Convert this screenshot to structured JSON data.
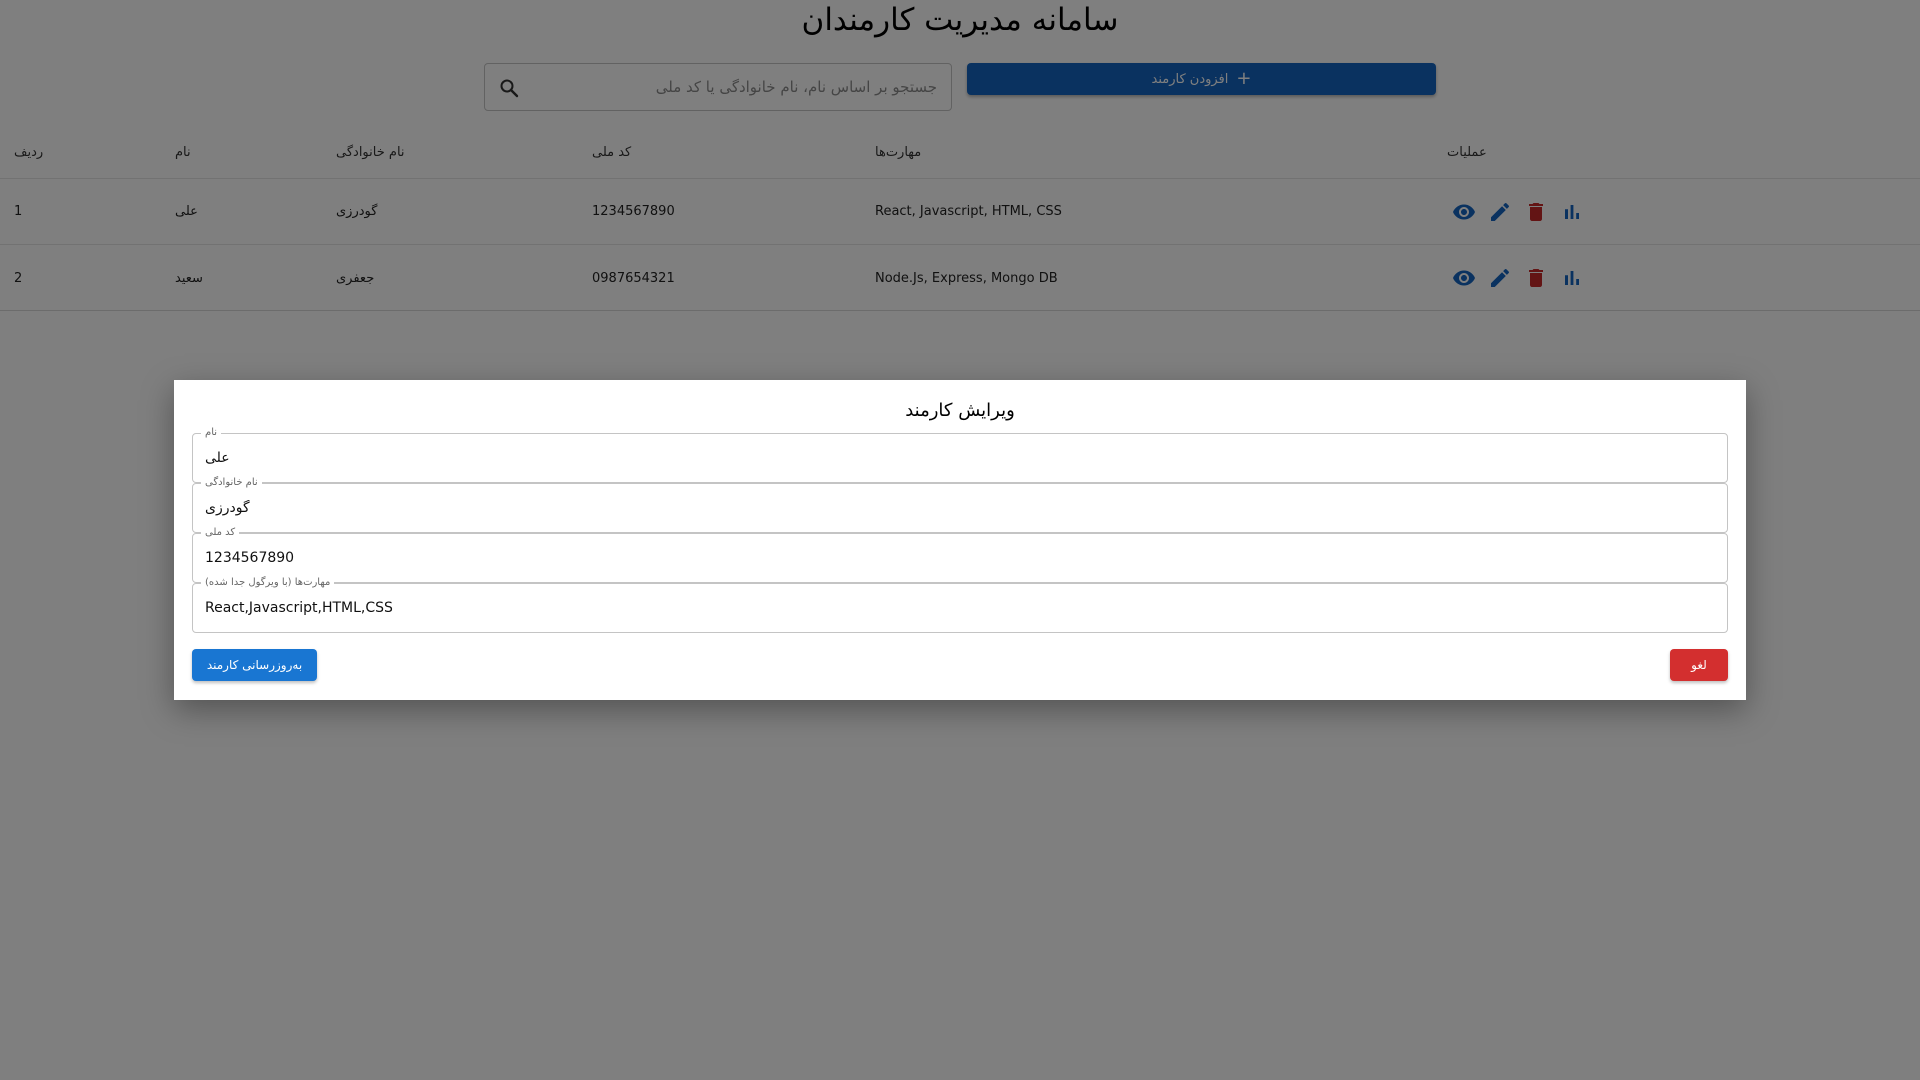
{
  "page": {
    "title": "سامانه مدیریت کارمندان"
  },
  "search": {
    "placeholder": "جستجو بر اساس نام، نام خانوادگی یا کد ملی",
    "value": ""
  },
  "toolbar": {
    "add_label": "افزودن کارمند",
    "add_icon": "plus-icon"
  },
  "table": {
    "headers": {
      "index": "ردیف",
      "name": "نام",
      "family": "نام خانوادگی",
      "national_id": "کد ملی",
      "skills": "مهارت‌ها",
      "operations": "عملیات"
    },
    "rows": [
      {
        "index": "1",
        "name": "علی",
        "family": "گودرزی",
        "national_id": "1234567890",
        "skills": "React, Javascript, HTML, CSS"
      },
      {
        "index": "2",
        "name": "سعید",
        "family": "جعفری",
        "national_id": "0987654321",
        "skills": "Node.Js, Express, Mongo DB"
      }
    ],
    "action_icons": [
      "eye-icon",
      "edit-icon",
      "delete-icon",
      "bar-chart-icon"
    ]
  },
  "dialog": {
    "title": "ویرایش کارمند",
    "fields": [
      {
        "label": "نام",
        "value": "علی"
      },
      {
        "label": "نام خانوادگی",
        "value": "گودرزی"
      },
      {
        "label": "کد ملی",
        "value": "1234567890"
      },
      {
        "label": "مهارت‌ها (با ویرگول جدا شده)",
        "value": "React,Javascript,HTML,CSS"
      }
    ],
    "update_label": "به‌روزرسانی کارمند",
    "cancel_label": "لغو"
  },
  "colors": {
    "primary": "#1565c0",
    "action_blue": "#1976d2",
    "danger": "#d32f2f",
    "overlay": "rgba(0,0,0,0.5)"
  }
}
